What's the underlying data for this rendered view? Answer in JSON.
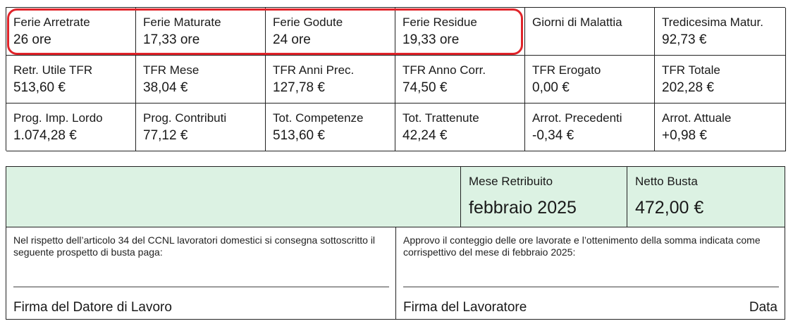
{
  "summary": {
    "cells": [
      {
        "label": "Ferie Arretrate",
        "value": "26 ore"
      },
      {
        "label": "Ferie Maturate",
        "value": "17,33 ore"
      },
      {
        "label": "Ferie Godute",
        "value": "24 ore"
      },
      {
        "label": "Ferie Residue",
        "value": "19,33 ore"
      },
      {
        "label": "Giorni di Malattia",
        "value": ""
      },
      {
        "label": "Tredicesima Matur.",
        "value": "92,73 €"
      },
      {
        "label": "Retr. Utile TFR",
        "value": "513,60 €"
      },
      {
        "label": "TFR Mese",
        "value": "38,04 €"
      },
      {
        "label": "TFR Anni Prec.",
        "value": "127,78 €"
      },
      {
        "label": "TFR Anno Corr.",
        "value": "74,50 €"
      },
      {
        "label": "TFR Erogato",
        "value": "0,00 €"
      },
      {
        "label": "TFR Totale",
        "value": "202,28 €"
      },
      {
        "label": "Prog. Imp. Lordo",
        "value": "1.074,28 €"
      },
      {
        "label": "Prog. Contributi",
        "value": "77,12 €"
      },
      {
        "label": "Tot. Competenze",
        "value": "513,60 €"
      },
      {
        "label": "Tot. Trattenute",
        "value": "42,24 €"
      },
      {
        "label": "Arrot. Precedenti",
        "value": "-0,34 €"
      },
      {
        "label": "Arrot. Attuale",
        "value": "+0,98 €"
      }
    ],
    "highlight_color": "#e0242a"
  },
  "payment": {
    "mese_label": "Mese Retribuito",
    "mese_value": "febbraio 2025",
    "netto_label": "Netto Busta",
    "netto_value": "472,00 €",
    "background_color": "#dcf2e3"
  },
  "signatures": {
    "employer_note": "Nel rispetto dell’articolo 34 del CCNL lavoratori domestici si consegna sottoscritto il seguente prospetto di busta paga:",
    "employer_caption": "Firma del Datore di Lavoro",
    "worker_note": "Approvo il conteggio delle ore lavorate e l’ottenimento della somma indicata come corrispettivo del mese di febbraio 2025:",
    "worker_caption": "Firma del Lavoratore",
    "date_label": "Data"
  }
}
